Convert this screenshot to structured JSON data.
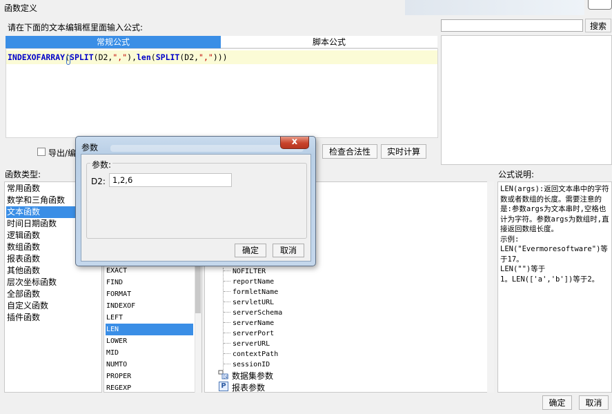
{
  "window": {
    "title": "函数定义"
  },
  "editor": {
    "prompt": "请在下面的文本编辑框里面输入公式:",
    "tabs": [
      "常规公式",
      "脚本公式"
    ],
    "formula_parts": [
      {
        "t": "INDEXOFARRAY",
        "c": "kw"
      },
      {
        "t": "(",
        "c": ""
      },
      {
        "t": "SPLIT",
        "c": "kw"
      },
      {
        "t": "(D2,",
        "c": ""
      },
      {
        "t": "\",\"",
        "c": "str"
      },
      {
        "t": "),",
        "c": ""
      },
      {
        "t": "len",
        "c": "kw"
      },
      {
        "t": "(",
        "c": ""
      },
      {
        "t": "SPLIT",
        "c": "kw"
      },
      {
        "t": "(D2,",
        "c": ""
      },
      {
        "t": "\",\"",
        "c": "str"
      },
      {
        "t": ")))",
        "c": ""
      }
    ]
  },
  "search": {
    "button": "搜索",
    "value": ""
  },
  "toolbar": {
    "export_label": "导出/编",
    "check_button": "检查合法性",
    "calc_button": "实时计算"
  },
  "categories": {
    "label": "函数类型:",
    "items": [
      "常用函数",
      "数学和三角函数",
      "文本函数",
      "时间日期函数",
      "逻辑函数",
      "数组函数",
      "报表函数",
      "其他函数",
      "层次坐标函数",
      "全部函数",
      "自定义函数",
      "插件函数"
    ],
    "selected": 2
  },
  "functions": {
    "items": [
      "EXACT",
      "FIND",
      "FORMAT",
      "INDEXOF",
      "LEFT",
      "LEN",
      "LOWER",
      "MID",
      "NUMTO",
      "PROPER",
      "REGEXP"
    ],
    "selected": 5
  },
  "params": {
    "items": [
      "NOFILTER",
      "reportName",
      "formletName",
      "servletURL",
      "serverSchema",
      "serverName",
      "serverPort",
      "serverURL",
      "contextPath",
      "sessionID"
    ],
    "dataset_label": "数据集参数",
    "report_label": "报表参数",
    "p_glyph": "P"
  },
  "description": {
    "label": "公式说明:",
    "lines": [
      "LEN(args):返回文本串中的字符数或者数组的长度。需要注意的是:参数args为文本串时,空格也计为字符。参数args为数组时,直接返回数组长度。",
      "示例:",
      "LEN(\"Evermoresoftware\")等于17。",
      "LEN(\"\")等于",
      "1。LEN(['a','b'])等于2。"
    ]
  },
  "footer": {
    "ok": "确定",
    "cancel": "取消"
  },
  "modal": {
    "title": "参数",
    "close_glyph": "x",
    "group_label": "参数:",
    "param_name": "D2:",
    "param_value": "1,2,6",
    "ok": "确定",
    "cancel": "取消"
  }
}
